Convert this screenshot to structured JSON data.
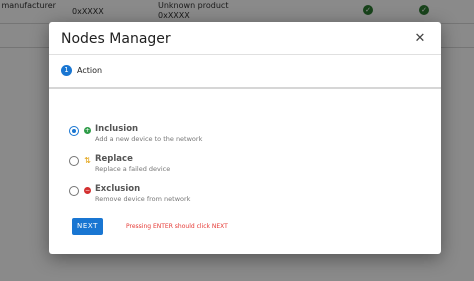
{
  "background": {
    "row": {
      "manufacturer": "e manufacturer",
      "id": "0xXXXX",
      "product": "Unknown product",
      "product_id": "0xXXXX",
      "check": "✓"
    }
  },
  "dialog": {
    "title": "Nodes Manager",
    "close_glyph": "✕",
    "step": {
      "number": "1",
      "label": "Action"
    },
    "options": [
      {
        "title": "Inclusion",
        "description": "Add a new device to the network",
        "icon": "plus-circle-icon",
        "icon_glyph": "+",
        "checked": true
      },
      {
        "title": "Replace",
        "description": "Replace a failed device",
        "icon": "swap-icon",
        "icon_glyph": "⇅",
        "checked": false
      },
      {
        "title": "Exclusion",
        "description": "Remove device from network",
        "icon": "minus-circle-icon",
        "icon_glyph": "−",
        "checked": false
      }
    ],
    "next_label": "NEXT",
    "hint": "Pressing ENTER should click NEXT"
  },
  "colors": {
    "primary": "#1976d2",
    "hint": "#e53935",
    "success": "#2e7d32"
  }
}
